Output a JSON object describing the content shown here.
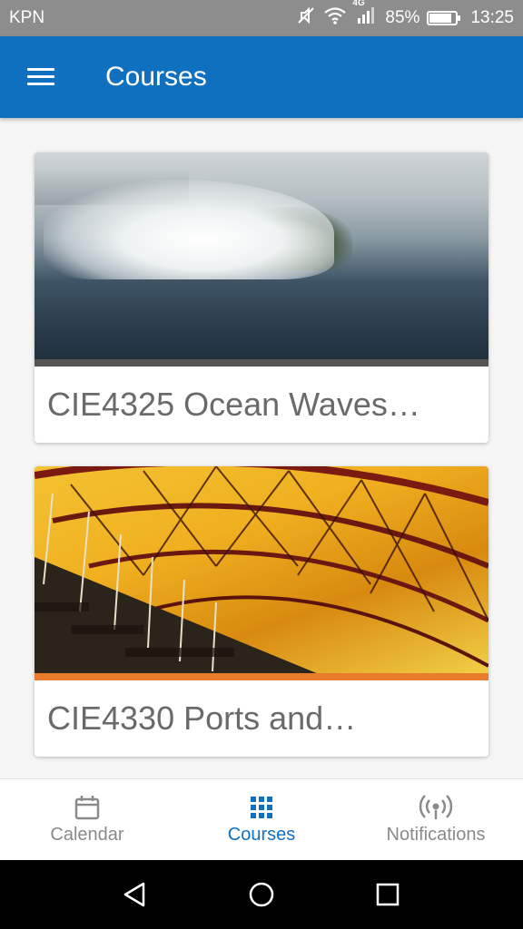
{
  "status_bar": {
    "carrier": "KPN",
    "network": "4G",
    "battery_percent": "85%",
    "battery_level": 0.85,
    "time": "13:25"
  },
  "app_bar": {
    "title": "Courses"
  },
  "courses": [
    {
      "title": "CIE4325 Ocean Waves…",
      "image": "ocean-wave-photo"
    },
    {
      "title": "CIE4330 Ports and…",
      "image": "stadium-roof-photo"
    }
  ],
  "bottom_nav": {
    "items": [
      {
        "label": "Calendar",
        "icon": "calendar-icon",
        "active": false
      },
      {
        "label": "Courses",
        "icon": "grid-icon",
        "active": true
      },
      {
        "label": "Notifications",
        "icon": "broadcast-icon",
        "active": false
      }
    ]
  },
  "colors": {
    "primary": "#1070c0",
    "status_bar": "#8d8d8d",
    "inactive": "#8a8a8a"
  }
}
